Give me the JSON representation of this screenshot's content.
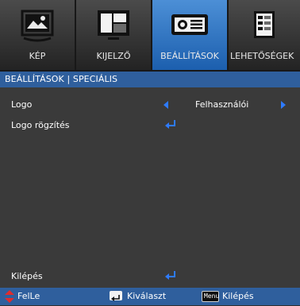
{
  "tabs": [
    {
      "label": "KÉP",
      "icon": "picture-icon"
    },
    {
      "label": "KIJELZŐ",
      "icon": "display-icon"
    },
    {
      "label": "BEÁLLÍTÁSOK",
      "icon": "projector-icon",
      "active": true
    },
    {
      "label": "LEHETŐSÉGEK",
      "icon": "document-icon"
    }
  ],
  "breadcrumb": "BEÁLLÍTÁSOK | SPECIÁLIS",
  "rows": [
    {
      "label": "Logo",
      "value": "Felhasználói"
    },
    {
      "label": "Logo rögzítés"
    },
    {
      "label": "Kilépés"
    }
  ],
  "footer": {
    "nav": "FelLe",
    "select": "Kiválaszt",
    "exit": "Kilépés",
    "menu_key": "Menu"
  },
  "colors": {
    "accent": "#2f5f9d",
    "active_tab": "#2f7fd0",
    "arrow": "#2e7bff"
  }
}
